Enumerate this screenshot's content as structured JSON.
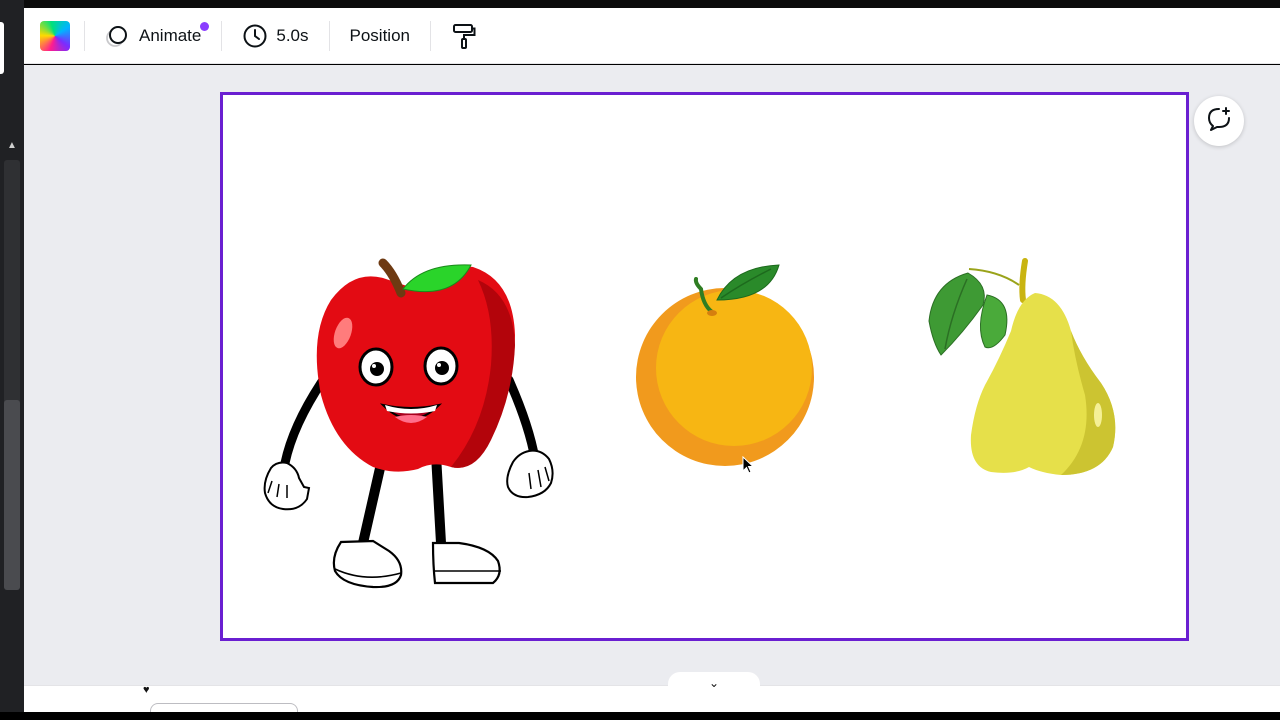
{
  "toolbar": {
    "color_swatch": "color-picker",
    "animate_label": "Animate",
    "duration_label": "5.0s",
    "position_label": "Position",
    "icons": {
      "animate": "animate-icon",
      "timer": "clock-icon",
      "copy_style": "paint-roller-icon"
    }
  },
  "canvas": {
    "border_color": "#6a1fd1",
    "background": "#ffffff",
    "elements": [
      {
        "name": "apple-character"
      },
      {
        "name": "orange"
      },
      {
        "name": "pear"
      }
    ]
  },
  "side": {
    "comment_icon": "add-comment-icon"
  },
  "colors": {
    "accent": "#8b3dff",
    "editor_bg": "#ebecf0",
    "apple_red": "#e30b13",
    "orange": "#f5a91a",
    "pear": "#e6e04a"
  }
}
